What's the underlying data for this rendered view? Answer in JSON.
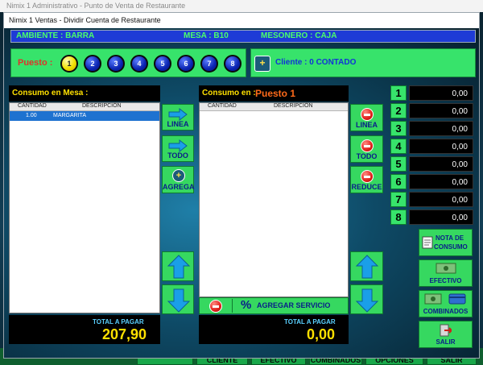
{
  "outer_window_title": "Nimix 1 Administrativo - Punto de Venta de Restaurante",
  "dialog_title": "Nimix 1 Ventas - Dividir Cuenta de Restaurante",
  "info": {
    "ambiente": "AMBIENTE : BARRA",
    "mesa": "MESA : B10",
    "mesonero": "MESONERO : CAJA"
  },
  "puesto": {
    "label": "Puesto :",
    "seats": [
      "1",
      "2",
      "3",
      "4",
      "5",
      "6",
      "7",
      "8"
    ],
    "active_seat": "1"
  },
  "cliente": {
    "icon": "plus-icon",
    "text": "Cliente : 0 CONTADO"
  },
  "left_panel": {
    "header": "Consumo en Mesa :",
    "columns": [
      "CANTIDAD",
      "DESCRIPCIÓN"
    ],
    "rows": [
      {
        "cantidad": "1.00",
        "descripcion": "MARGARITA"
      }
    ],
    "total_label": "TOTAL A PAGAR",
    "total_value": "207,90"
  },
  "middle_buttons": {
    "linea": "LINEA",
    "todo": "TODO",
    "agrega": "AGREGA"
  },
  "right_panel": {
    "header": "Consumo en :",
    "puesto_value": "Puesto 1",
    "columns": [
      "CANTIDAD",
      "DESCRIPCIÓN"
    ],
    "rows": [],
    "total_label": "TOTAL A PAGAR",
    "total_value": "0,00",
    "agregar_servicio": "AGREGAR SERVICIO"
  },
  "right_buttons": {
    "linea": "LINEA",
    "todo": "TODO",
    "reduce": "REDUCE"
  },
  "seat_totals": [
    {
      "num": "1",
      "value": "0,00"
    },
    {
      "num": "2",
      "value": "0,00"
    },
    {
      "num": "3",
      "value": "0,00"
    },
    {
      "num": "4",
      "value": "0,00"
    },
    {
      "num": "5",
      "value": "0,00"
    },
    {
      "num": "6",
      "value": "0,00"
    },
    {
      "num": "7",
      "value": "0,00"
    },
    {
      "num": "8",
      "value": "0,00"
    }
  ],
  "actions": {
    "nota_line1": "NOTA DE",
    "nota_line2": "CONSUMO",
    "efectivo": "EFECTIVO",
    "combinados": "COMBINADOS",
    "salir": "SALIR"
  },
  "background_footer": [
    "CLIENTE",
    "EFECTIVO",
    "COMBINADOS",
    "OPCIONES",
    "SALIR"
  ],
  "colors": {
    "accent_green": "#36d860",
    "info_bar_blue": "#1e3bd6",
    "total_yellow": "#ffe000",
    "puesto_red": "#e0302a"
  }
}
